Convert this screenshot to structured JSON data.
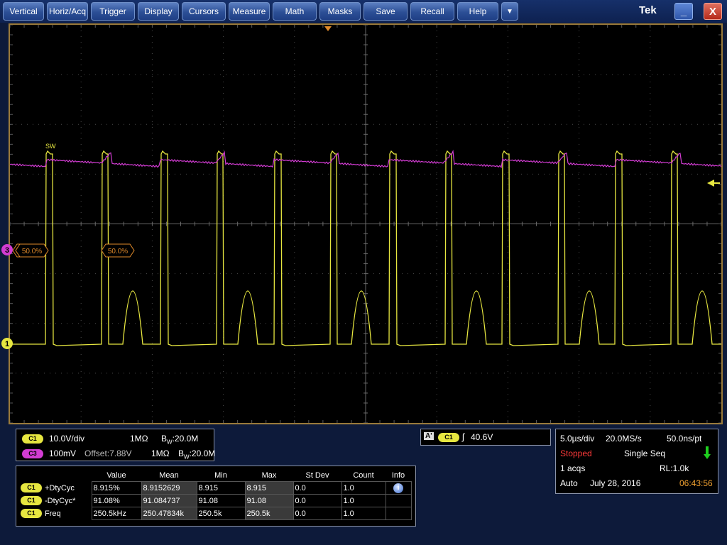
{
  "menu": {
    "items": [
      "Vertical",
      "Horiz/Acq",
      "Trigger",
      "Display",
      "Cursors",
      "Measure",
      "Math",
      "Masks",
      "Save",
      "Recall",
      "Help"
    ],
    "more": "▼",
    "brand": "Tek",
    "minimize": "_",
    "close": "X"
  },
  "waveform": {
    "ch1_marker": "1",
    "ch3_marker": "3",
    "ch3_level_label": "50.0%",
    "ch3_ref_label": "50.0%",
    "ch1_ref_label": "50.0%",
    "sw_label": "SW",
    "colors": {
      "ch1": "#e6e640",
      "ch3": "#d23cd2",
      "ref": "#e08a2a",
      "grid": "#4a4a4a"
    }
  },
  "channels": {
    "c1": {
      "badge": "C1",
      "scale": "10.0V/div",
      "impedance": "1MΩ",
      "bw_prefix": "B",
      "bw_sub": "W",
      "bw_value": ":20.0M"
    },
    "c3": {
      "badge": "C3",
      "scale": "100mV",
      "offset": "Offset:7.88V",
      "impedance": "1MΩ",
      "bw_prefix": "B",
      "bw_sub": "W",
      "bw_value": ":20.0M"
    }
  },
  "trigger": {
    "type": "A'",
    "source": "C1",
    "level": "40.6V"
  },
  "acquisition": {
    "time_div": "5.0µs/div",
    "sample_rate": "20.0MS/s",
    "resolution": "50.0ns/pt",
    "status": "Stopped",
    "mode": "Single Seq",
    "acqs": "1 acqs",
    "rl": "RL:1.0k",
    "trigger_mode": "Auto",
    "date": "July 28, 2016",
    "time": "06:43:56"
  },
  "measurements": {
    "headers": [
      "Value",
      "Mean",
      "Min",
      "Max",
      "St Dev",
      "Count",
      "Info"
    ],
    "rows": [
      {
        "badge": "C1",
        "name": "+DtyCyc",
        "value": "8.915%",
        "mean": "8.9152629",
        "min": "8.915",
        "max": "8.915",
        "stdev": "0.0",
        "count": "1.0"
      },
      {
        "badge": "C1",
        "name": "-DtyCyc*",
        "value": "91.08%",
        "mean": "91.084737",
        "min": "91.08",
        "max": "91.08",
        "stdev": "0.0",
        "count": "1.0"
      },
      {
        "badge": "C1",
        "name": "Freq",
        "value": "250.5kHz",
        "mean": "250.47834k",
        "min": "250.5k",
        "max": "250.5k",
        "stdev": "0.0",
        "count": "1.0"
      }
    ],
    "info_icon": "i"
  }
}
